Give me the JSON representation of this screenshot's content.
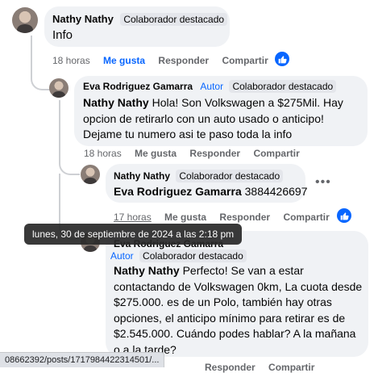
{
  "comments": [
    {
      "author": "Nathy Nathy",
      "badge": "Colaborador destacado",
      "text": "Info",
      "meta": {
        "time": "18 horas",
        "like": "Me gusta",
        "reply": "Responder",
        "share": "Compartir"
      }
    },
    {
      "author": "Eva Rodriguez Gamarra",
      "author_tag": "Autor",
      "badge": "Colaborador destacado",
      "text_name": "Nathy Nathy",
      "text_line1": "Hola! Son Volkswagen a $275Mil. Hay",
      "text_line2": "opcion de retirarlo con un auto usado o anticipo!",
      "text_line3": "Dejame tu numero asi te paso toda la info",
      "meta": {
        "time": "18 horas",
        "like": "Me gusta",
        "reply": "Responder",
        "share": "Compartir"
      }
    },
    {
      "author": "Nathy Nathy",
      "badge": "Colaborador destacado",
      "text_name": "Eva Rodriguez Gamarra",
      "text": "3884426697",
      "meta": {
        "time": "17 horas",
        "like": "Me gusta",
        "reply": "Responder",
        "share": "Compartir"
      }
    },
    {
      "author": "Eva Rodriguez Gamarra",
      "author_tag": "Autor",
      "badge": "Colaborador destacado",
      "text_name": "Nathy Nathy",
      "text_line1": "Perfecto! Se van a estar",
      "text_line2": "contactando de Volkswagen 0km, La cuota desde",
      "text_line3": "$275.000. es de un Polo, también hay otras",
      "text_line4": "opciones, el anticipo mínimo para retirar es de",
      "text_line5": "$2.545.000. Cuándo podes hablar? A la mañana",
      "text_line6": "o a la tarde?",
      "meta": {
        "reply": "Responder",
        "share": "Compartir"
      }
    }
  ],
  "tooltip": "lunes, 30 de septiembre de 2024 a las 2:18 pm",
  "status_url": "08662392/posts/1717984422314501/...",
  "colors": {
    "accent": "#0866ff",
    "bubble": "#f0f2f5",
    "meta": "#65676b"
  }
}
